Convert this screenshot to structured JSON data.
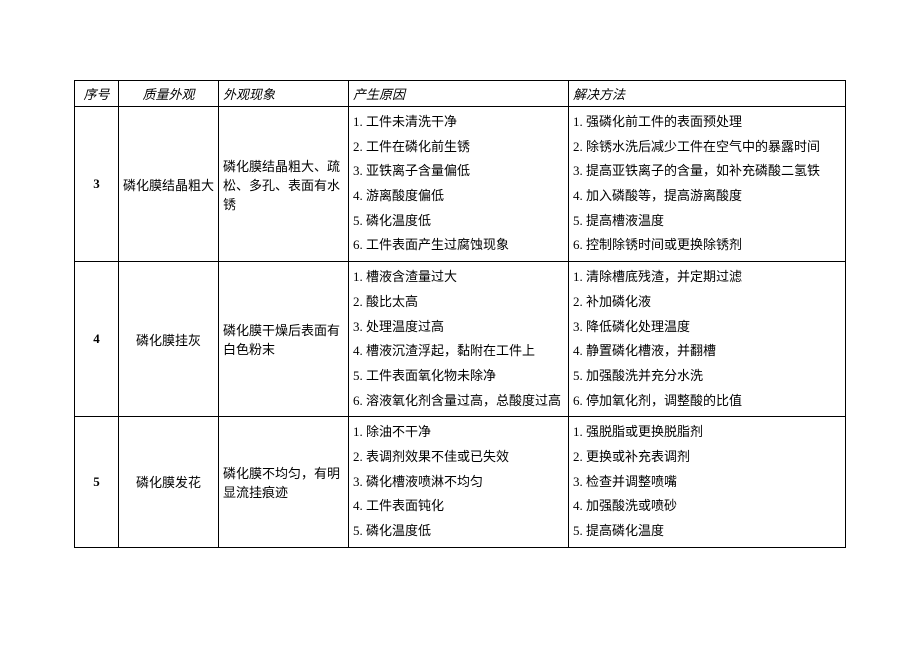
{
  "headers": {
    "idx": "序号",
    "quality_appearance": "质量外观",
    "appearance_phenomenon": "外观现象",
    "cause": "产生原因",
    "solution": "解决方法"
  },
  "rows": [
    {
      "idx": "3",
      "quality_appearance": "磷化膜结晶粗大",
      "appearance_phenomenon": "磷化膜结晶粗大、疏松、多孔、表面有水锈",
      "causes": [
        "1. 工件未清洗干净",
        "2. 工件在磷化前生锈",
        "3. 亚铁离子含量偏低",
        "4. 游离酸度偏低",
        "5. 磷化温度低",
        "6. 工件表面产生过腐蚀现象"
      ],
      "solutions": [
        "1. 强磷化前工件的表面预处理",
        "2. 除锈水洗后减少工件在空气中的暴露时间",
        "3. 提高亚铁离子的含量，如补充磷酸二氢铁",
        "4. 加入磷酸等，提高游离酸度",
        "5. 提高槽液温度",
        "6. 控制除锈时间或更换除锈剂"
      ]
    },
    {
      "idx": "4",
      "quality_appearance": "磷化膜挂灰",
      "appearance_phenomenon": "磷化膜干燥后表面有白色粉末",
      "causes": [
        "1. 槽液含渣量过大",
        "2. 酸比太高",
        "3. 处理温度过高",
        "4. 槽液沉渣浮起，黏附在工件上",
        "5. 工件表面氧化物未除净",
        "6. 溶液氧化剂含量过高，总酸度过高"
      ],
      "solutions": [
        "1. 清除槽底残渣，并定期过滤",
        "2. 补加磷化液",
        "3. 降低磷化处理温度",
        "4. 静置磷化槽液，并翻槽",
        "5. 加强酸洗并充分水洗",
        "6. 停加氧化剂，调整酸的比值"
      ]
    },
    {
      "idx": "5",
      "quality_appearance": "磷化膜发花",
      "appearance_phenomenon": "磷化膜不均匀，有明显流挂痕迹",
      "causes": [
        "1. 除油不干净",
        "2. 表调剂效果不佳或已失效",
        "3. 磷化槽液喷淋不均匀",
        "4. 工件表面钝化",
        "5. 磷化温度低"
      ],
      "solutions": [
        "1. 强脱脂或更换脱脂剂",
        "2. 更换或补充表调剂",
        "3. 检查并调整喷嘴",
        "4. 加强酸洗或喷砂",
        "5. 提高磷化温度"
      ]
    }
  ]
}
